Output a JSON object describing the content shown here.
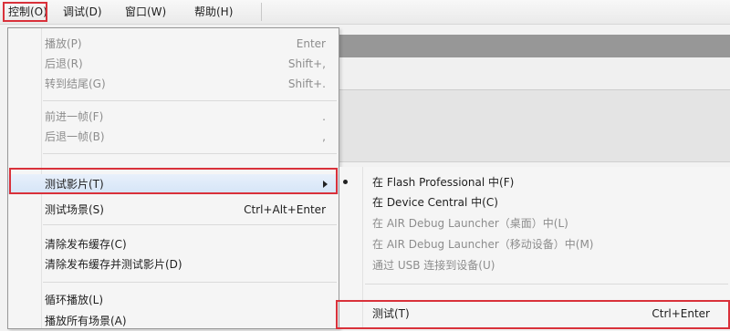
{
  "menubar": {
    "items": [
      "控制(O)",
      "调试(D)",
      "窗口(W)",
      "帮助(H)"
    ]
  },
  "control_menu": {
    "items": [
      {
        "label": "播放(P)",
        "shortcut": "Enter",
        "enabled": false
      },
      {
        "label": "后退(R)",
        "shortcut": "Shift+,",
        "enabled": false
      },
      {
        "label": "转到结尾(G)",
        "shortcut": "Shift+.",
        "enabled": false
      },
      {
        "label": "前进一帧(F)",
        "shortcut": ".",
        "enabled": false
      },
      {
        "label": "后退一帧(B)",
        "shortcut": ",",
        "enabled": false
      },
      {
        "label": "测试影片(T)",
        "shortcut": "",
        "enabled": true,
        "submenu": true
      },
      {
        "label": "测试场景(S)",
        "shortcut": "Ctrl+Alt+Enter",
        "enabled": true
      },
      {
        "label": "清除发布缓存(C)",
        "shortcut": "",
        "enabled": true
      },
      {
        "label": "清除发布缓存并测试影片(D)",
        "shortcut": "",
        "enabled": true
      },
      {
        "label": "循环播放(L)",
        "shortcut": "",
        "enabled": true
      },
      {
        "label": "播放所有场景(A)",
        "shortcut": "",
        "enabled": true
      }
    ]
  },
  "test_movie_submenu": {
    "items": [
      {
        "label": "在 Flash Professional 中(F)",
        "shortcut": "",
        "enabled": true,
        "checked": true
      },
      {
        "label": "在 Device Central 中(C)",
        "shortcut": "",
        "enabled": true
      },
      {
        "label": "在 AIR Debug Launcher（桌面）中(L)",
        "shortcut": "",
        "enabled": false
      },
      {
        "label": "在 AIR Debug Launcher（移动设备）中(M)",
        "shortcut": "",
        "enabled": false
      },
      {
        "label": "通过 USB 连接到设备(U)",
        "shortcut": "",
        "enabled": false
      },
      {
        "label": "测试(T)",
        "shortcut": "Ctrl+Enter",
        "enabled": true
      }
    ]
  },
  "colors": {
    "highlight_border": "#d9313a",
    "disabled_text": "#8d8d8d",
    "menu_bg": "#f5f5f5"
  }
}
